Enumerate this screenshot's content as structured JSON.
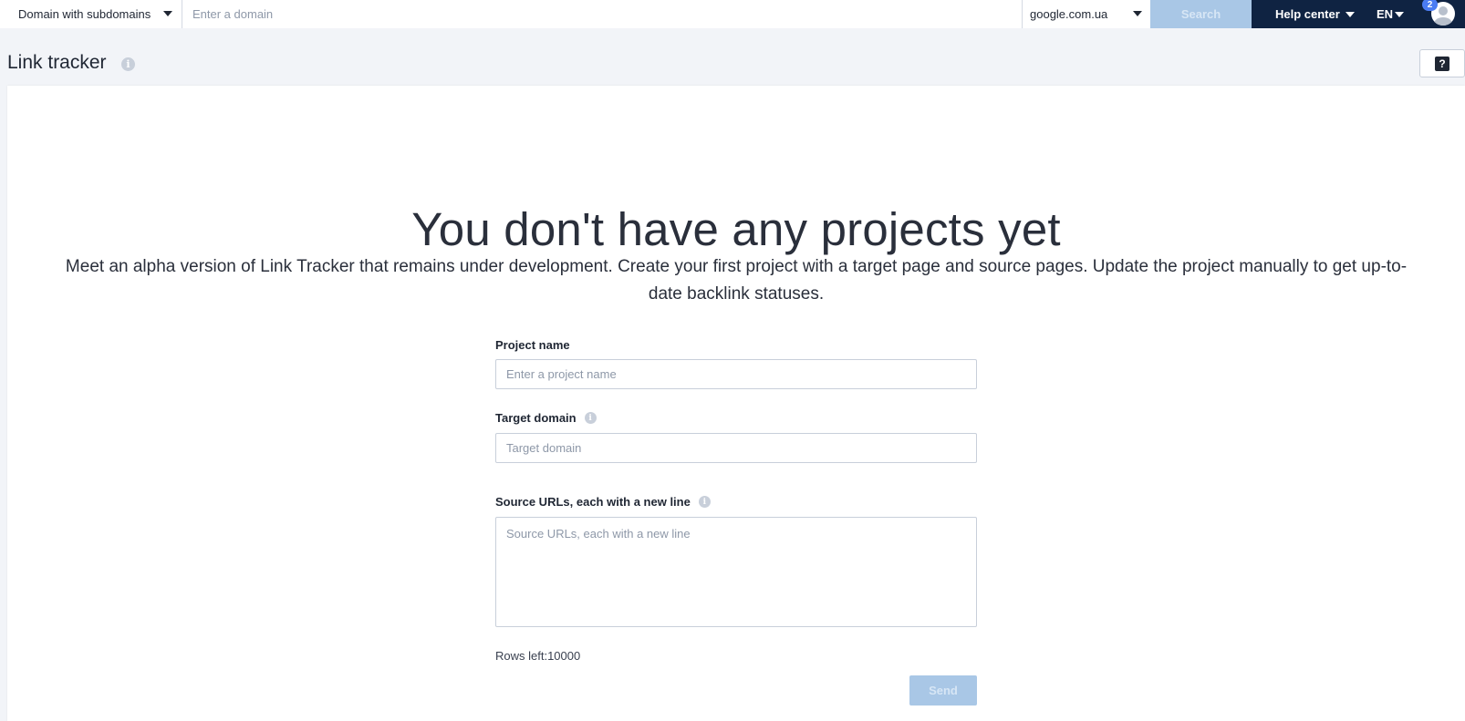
{
  "topbar": {
    "scope_label": "Domain with subdomains",
    "domain_placeholder": "Enter a domain",
    "database_label": "google.com.ua",
    "search_label": "Search",
    "help_center_label": "Help center",
    "language_label": "EN",
    "notification_count": "2"
  },
  "header": {
    "title": "Link tracker",
    "info_glyph": "i",
    "help_glyph": "?"
  },
  "empty_state": {
    "title": "You don't have any projects yet",
    "description": "Meet an alpha version of Link Tracker that remains under development. Create your first project with a target page and source pages. Update the project manually to get up-to-date backlink statuses."
  },
  "form": {
    "project_name_label": "Project name",
    "project_name_placeholder": "Enter a project name",
    "target_domain_label": "Target domain",
    "target_domain_placeholder": "Target domain",
    "source_urls_label": "Source URLs, each with a new line",
    "source_urls_placeholder": "Source URLs, each with a new line",
    "rows_left": "Rows left:10000",
    "send_label": "Send",
    "info_glyph": "i"
  },
  "colors": {
    "topbar_bg": "#0f2342",
    "disabled_button": "#a9c7e6",
    "badge": "#4b7cf3"
  },
  "icons": [
    "chevron-down-icon",
    "info-icon",
    "help-icon",
    "user-avatar-icon"
  ]
}
